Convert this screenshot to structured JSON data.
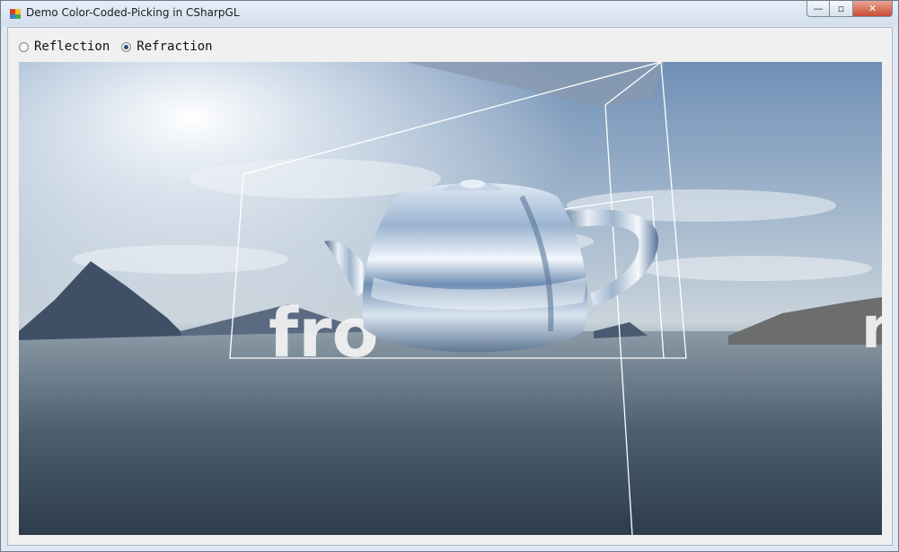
{
  "window": {
    "title": "Demo Color-Coded-Picking in CSharpGL",
    "buttons": {
      "minimize": "—",
      "maximize": "▫",
      "close": "✕"
    }
  },
  "options": [
    {
      "label": "Reflection",
      "selected": false
    },
    {
      "label": "Refraction",
      "selected": true
    }
  ],
  "scene": {
    "overlay_text_left": "fro",
    "overlay_text_right": "r"
  }
}
